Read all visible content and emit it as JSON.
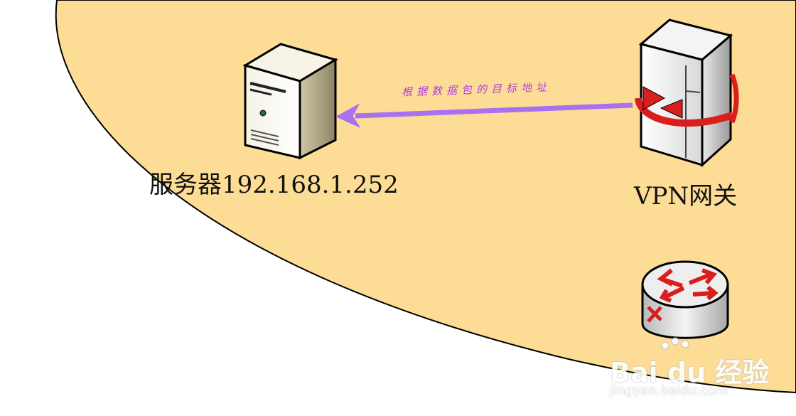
{
  "diagram": {
    "server_label": "服务器192.168.1.252",
    "vpn_label": "VPN网关",
    "arrow_label": "根据数据包的目标地址",
    "network_region_color": "#FDDD95",
    "arrow_color": "#A970F0"
  },
  "watermark": {
    "main": "Bai du 经验",
    "sub": "jingyan.baidu.com"
  }
}
